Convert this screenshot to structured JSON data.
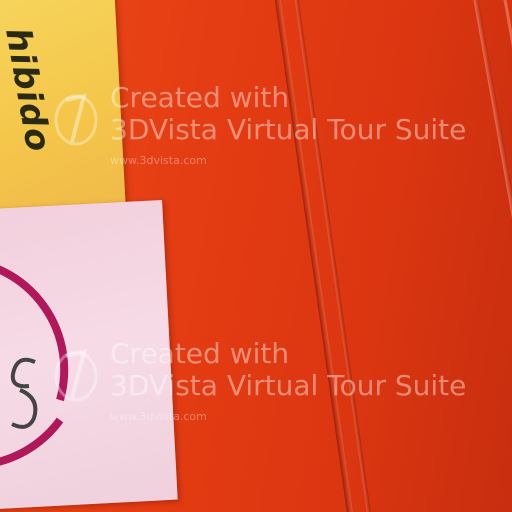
{
  "scene": {
    "yellow_sticker_text": "hibido"
  },
  "watermarks": [
    {
      "line1": "Created with",
      "line2": "3DVista Virtual Tour Suite",
      "url": "www.3dvista.com"
    },
    {
      "line1": "Created with",
      "line2": "3DVista Virtual Tour Suite",
      "url": "www.3dvista.com"
    }
  ],
  "colors": {
    "wall_red": "#e23a12",
    "yellow_sticker": "#f4c64a",
    "pink_sticker": "#f2cfdc",
    "symbol_crimson": "#b0185a"
  }
}
